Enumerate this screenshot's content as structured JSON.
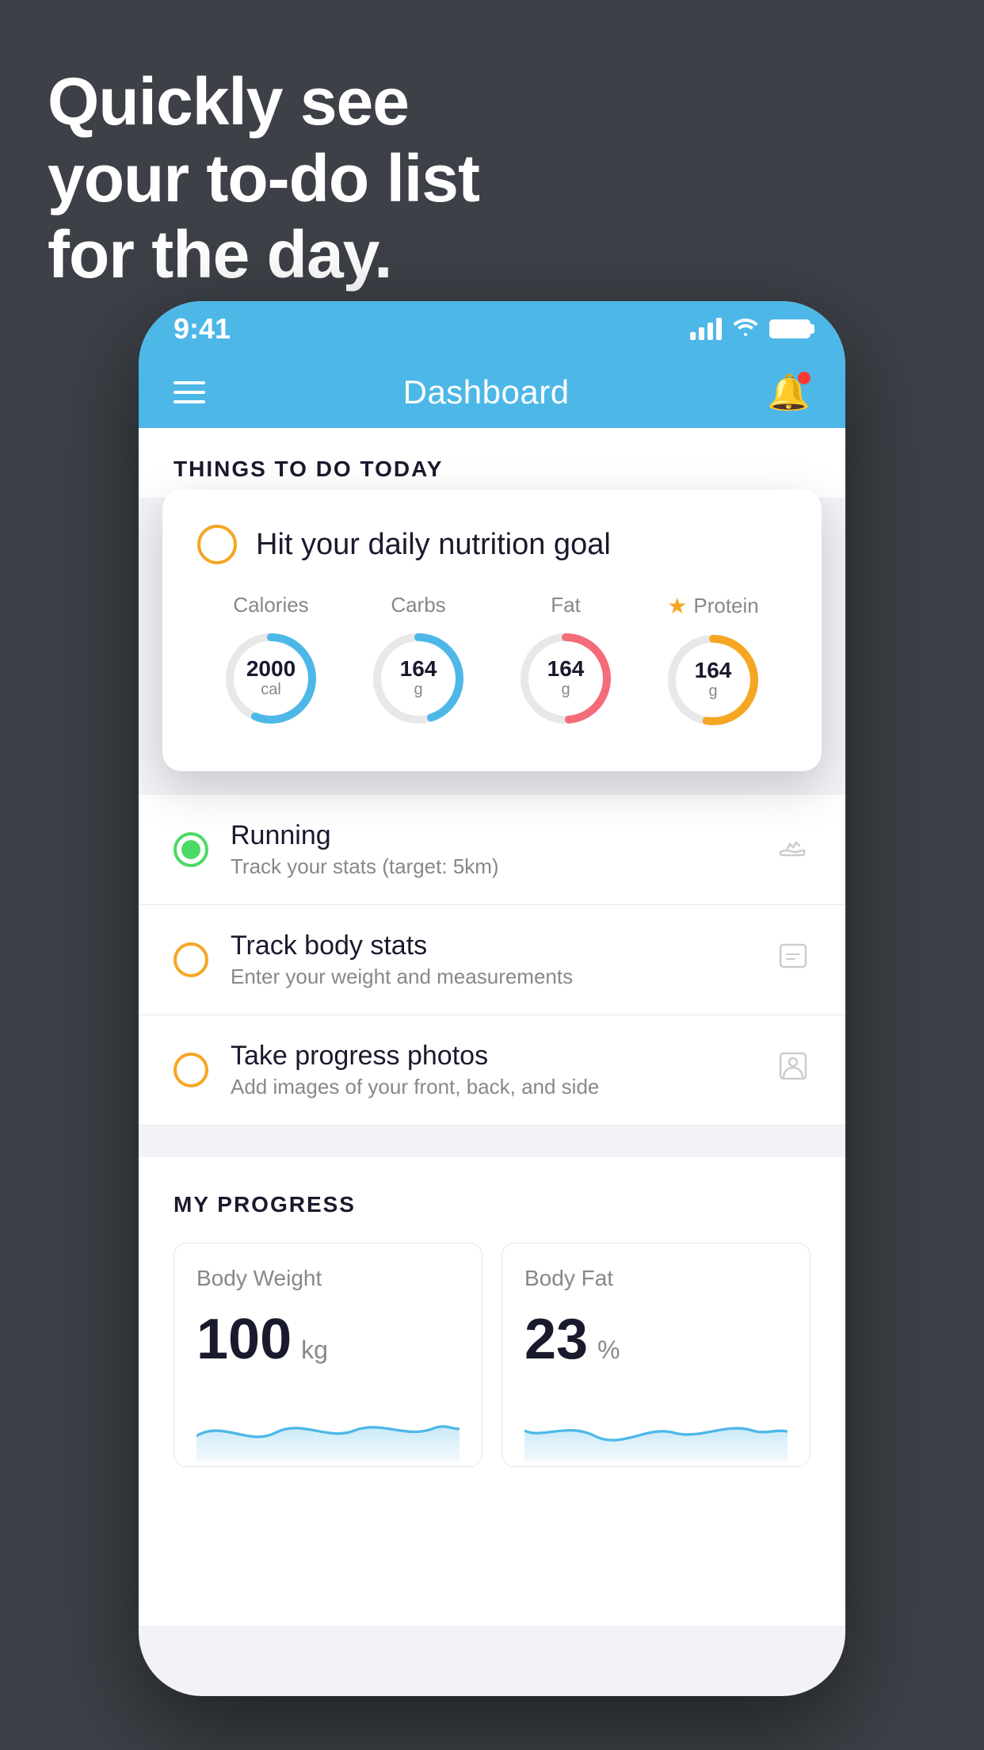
{
  "background": {
    "color": "#3d4147"
  },
  "headline": {
    "line1": "Quickly see",
    "line2": "your to-do list",
    "line3": "for the day."
  },
  "status_bar": {
    "time": "9:41",
    "color": "#4db8e8"
  },
  "nav": {
    "title": "Dashboard",
    "color": "#4db8e8"
  },
  "things_section": {
    "title": "THINGS TO DO TODAY"
  },
  "nutrition_card": {
    "checkbox_type": "yellow_empty",
    "title": "Hit your daily nutrition goal",
    "items": [
      {
        "label": "Calories",
        "value": "2000",
        "unit": "cal",
        "color": "#4db8e8",
        "track": 75,
        "star": false
      },
      {
        "label": "Carbs",
        "value": "164",
        "unit": "g",
        "color": "#4db8e8",
        "track": 60,
        "star": false
      },
      {
        "label": "Fat",
        "value": "164",
        "unit": "g",
        "color": "#f46b7a",
        "track": 65,
        "star": false
      },
      {
        "label": "Protein",
        "value": "164",
        "unit": "g",
        "color": "#f5a623",
        "track": 70,
        "star": true
      }
    ]
  },
  "todo_items": [
    {
      "id": "running",
      "name": "Running",
      "sub": "Track your stats (target: 5km)",
      "circle": "green",
      "icon": "shoe"
    },
    {
      "id": "body_stats",
      "name": "Track body stats",
      "sub": "Enter your weight and measurements",
      "circle": "yellow",
      "icon": "scale"
    },
    {
      "id": "progress_photos",
      "name": "Take progress photos",
      "sub": "Add images of your front, back, and side",
      "circle": "yellow",
      "icon": "person"
    }
  ],
  "progress_section": {
    "title": "MY PROGRESS",
    "cards": [
      {
        "id": "body_weight",
        "title": "Body Weight",
        "value": "100",
        "unit": "kg"
      },
      {
        "id": "body_fat",
        "title": "Body Fat",
        "value": "23",
        "unit": "%"
      }
    ]
  }
}
